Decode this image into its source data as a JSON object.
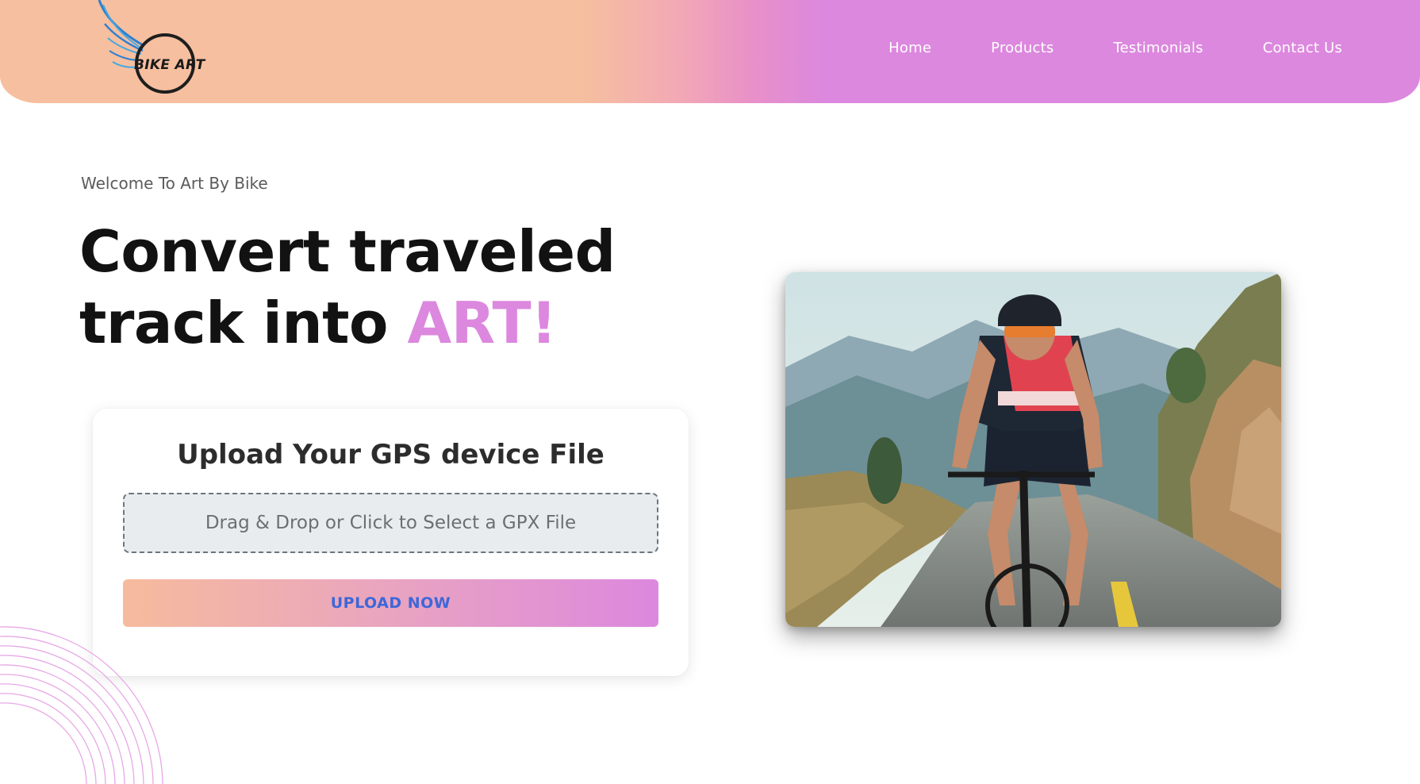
{
  "brand": {
    "logo_text": "BIKE ART"
  },
  "nav": {
    "items": [
      {
        "label": "Home"
      },
      {
        "label": "Products"
      },
      {
        "label": "Testimonials"
      },
      {
        "label": "Contact Us"
      }
    ]
  },
  "hero": {
    "welcome": "Welcome To Art By Bike",
    "headline_line1": "Convert traveled",
    "headline_line2_prefix": "track into ",
    "headline_accent": "ART!"
  },
  "upload": {
    "title": "Upload Your GPS device File",
    "dropzone_text": "Drag & Drop or Click to Select a GPX File",
    "button_label": "UPLOAD NOW"
  },
  "colors": {
    "header_peach": "#f6bf9f",
    "header_pink": "#dc88de",
    "accent": "#dc88de",
    "button_text": "#3d67d8"
  },
  "icons": {
    "logo": "winged-wheel-icon"
  }
}
